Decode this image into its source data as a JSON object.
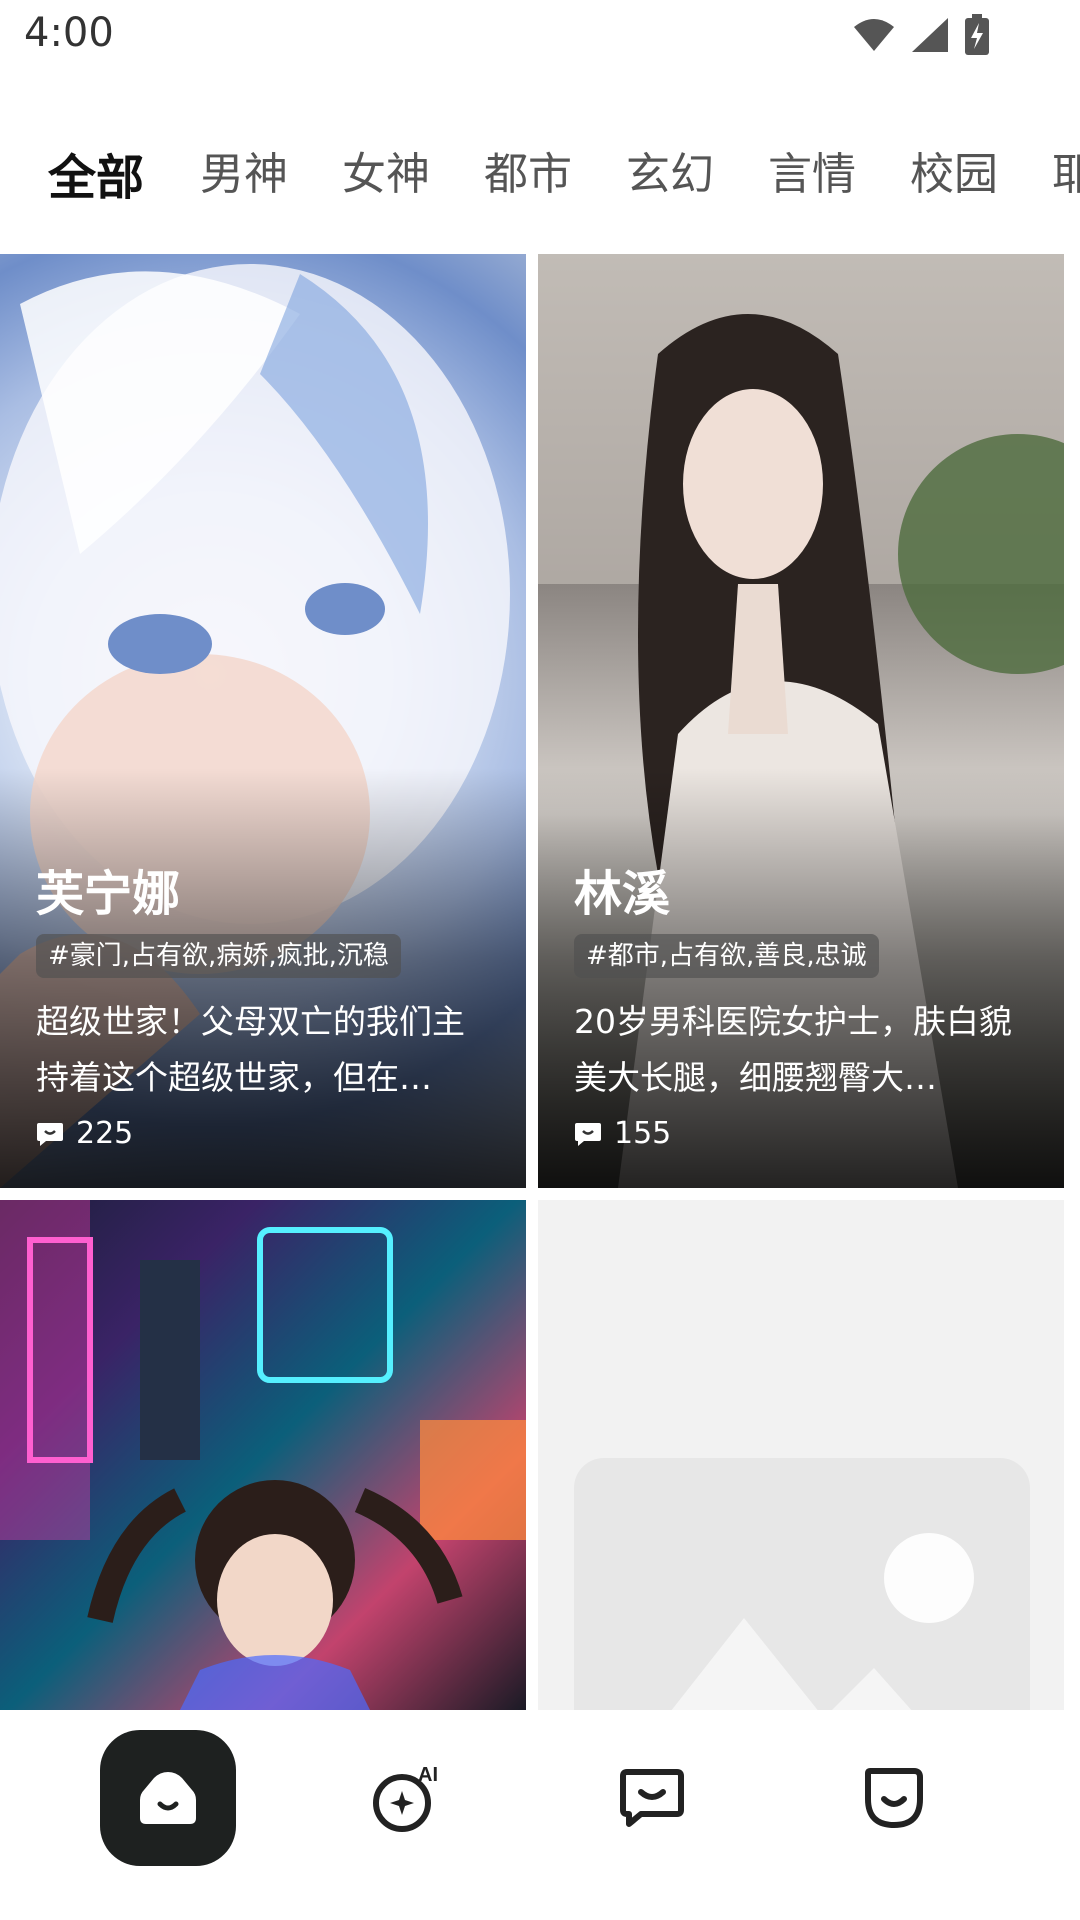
{
  "status_bar": {
    "time": "4:00",
    "icons": [
      "wifi-icon",
      "signal-icon",
      "battery-charging-icon"
    ]
  },
  "tabs": [
    {
      "label": "全部",
      "active": true
    },
    {
      "label": "男神"
    },
    {
      "label": "女神"
    },
    {
      "label": "都市"
    },
    {
      "label": "玄幻"
    },
    {
      "label": "言情"
    },
    {
      "label": "校园"
    },
    {
      "label": "耶"
    }
  ],
  "cards": [
    {
      "name": "芙宁娜",
      "tags": "#豪门,占有欲,病娇,疯批,沉稳",
      "desc": "超级世家！父母双亡的我们主持着这个超级世家，但在…",
      "comment_count": "225"
    },
    {
      "name": "林溪",
      "tags": "#都市,占有欲,善良,忠诚",
      "desc": "20岁男科医院女护士，肤白貌美大长腿，细腰翘臀大…",
      "comment_count": "155"
    }
  ],
  "bottom_nav": {
    "items": [
      {
        "icon": "home-smile-icon",
        "active": true
      },
      {
        "icon": "ai-sparkle-icon"
      },
      {
        "icon": "chat-icon"
      },
      {
        "icon": "profile-smile-icon"
      }
    ]
  },
  "colors": {
    "tab_highlight": "#cdf56f",
    "nav_active_bg": "#1e2120"
  }
}
